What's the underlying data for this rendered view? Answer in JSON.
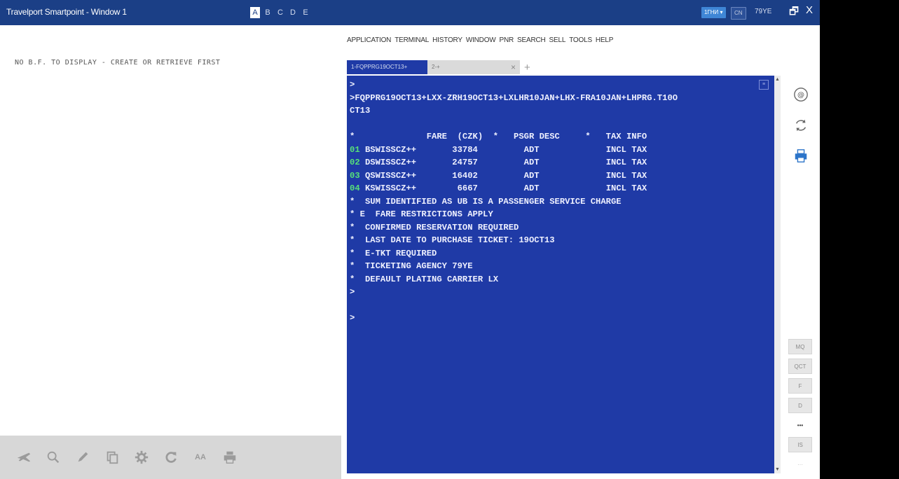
{
  "window": {
    "title": "Travelport Smartpoint - Window 1",
    "tabs": [
      "A",
      "B",
      "C",
      "D",
      "E"
    ],
    "active_tab": "A",
    "pill_left": "1ГНИ ▾",
    "pill_right": "CN",
    "pcc": "79YE",
    "restore_glyph": "🗗",
    "close_glyph": "X"
  },
  "left": {
    "message": "NO B.F. TO DISPLAY - CREATE OR RETRIEVE FIRST"
  },
  "toolbar": {
    "icons": [
      "plane-icon",
      "search-icon",
      "pencil-icon",
      "copy-icon",
      "gear-icon",
      "refresh-icon",
      "text-size-icon",
      "print-icon"
    ],
    "text_size_label": "AA"
  },
  "menu": [
    "APPLICATION",
    "TERMINAL",
    "HISTORY",
    "WINDOW",
    "PNR",
    "SEARCH",
    "SELL",
    "TOOLS",
    "HELP"
  ],
  "terminal_tabs": {
    "active": "1-FQPPRG19OCT13+",
    "inactive": "2-+",
    "close": "×",
    "add": "+"
  },
  "terminal": {
    "lines": [
      ">",
      ">FQPPRG19OCT13+LXX-ZRH19OCT13+LXLHR10JAN+LHX-FRA10JAN+LHPRG.T10O",
      "CT13",
      "",
      "*              FARE  (CZK)  *   PSGR DESC     *   TAX INFO",
      "01 BSWISSCZ++       33784         ADT             INCL TAX",
      "02 DSWISSCZ++       24757         ADT             INCL TAX",
      "03 QSWISSCZ++       16402         ADT             INCL TAX",
      "04 KSWISSCZ++        6667         ADT             INCL TAX",
      "*  SUM IDENTIFIED AS UB IS A PASSENGER SERVICE CHARGE",
      "* E  FARE RESTRICTIONS APPLY",
      "*  CONFIRMED RESERVATION REQUIRED",
      "*  LAST DATE TO PURCHASE TICKET: 19OCT13",
      "*  E-TKT REQUIRED",
      "*  TICKETING AGENCY 79YE",
      "*  DEFAULT PLATING CARRIER LX",
      ">",
      "",
      ">"
    ],
    "corner_label": "≡"
  },
  "side_buttons": [
    "MQ",
    "QCT",
    "F",
    "D",
    "•••",
    "IS",
    "···"
  ],
  "colors": {
    "terminal_bg": "#1f3aa6",
    "terminal_text": "#eef0ff",
    "line_number": "#57e07a",
    "titlebar": "#1b3f86"
  }
}
